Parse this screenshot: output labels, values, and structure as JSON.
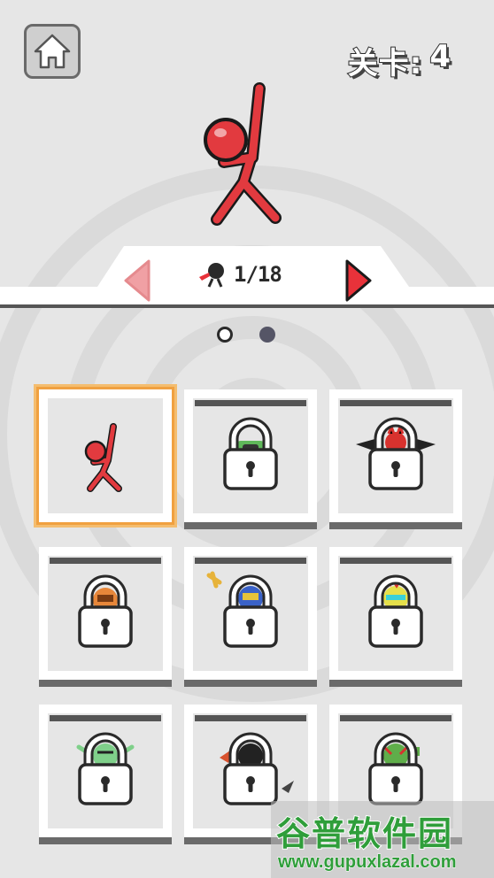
{
  "header": {
    "home_icon": "home-icon",
    "level_label": "关卡:",
    "level_value": "4"
  },
  "selector": {
    "counter": "1/18",
    "counter_icon": "ninja-head-icon",
    "prev_icon": "arrow-left-icon",
    "next_icon": "arrow-right-icon",
    "accent_color": "#e8323a"
  },
  "pages": {
    "total": 2,
    "current": 2
  },
  "skins": [
    {
      "id": 1,
      "name": "red-stickman",
      "locked": false,
      "selected": true
    },
    {
      "id": 2,
      "name": "green-goggles-stickman",
      "locked": true,
      "selected": false
    },
    {
      "id": 3,
      "name": "devil-bat-stickman",
      "locked": true,
      "selected": false
    },
    {
      "id": 4,
      "name": "orange-stickman",
      "locked": true,
      "selected": false
    },
    {
      "id": 5,
      "name": "blue-caped-stickman",
      "locked": true,
      "selected": false
    },
    {
      "id": 6,
      "name": "sunglasses-stickman",
      "locked": true,
      "selected": false
    },
    {
      "id": 7,
      "name": "zombie-stickman",
      "locked": true,
      "selected": false
    },
    {
      "id": 8,
      "name": "ninja-stickman",
      "locked": true,
      "selected": false
    },
    {
      "id": 9,
      "name": "green-monster-stickman",
      "locked": true,
      "selected": false
    }
  ],
  "watermark": {
    "title": "谷普软件园",
    "url": "www.gupuxlazal.com"
  },
  "colors": {
    "background": "#e6e6e6",
    "selected_border": "#f0a040",
    "watermark_green": "#2f9e3a"
  }
}
